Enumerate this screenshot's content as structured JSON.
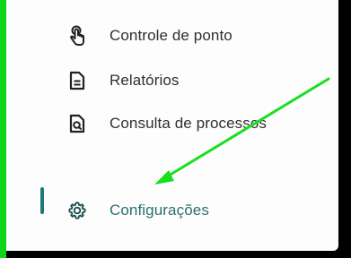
{
  "menu": {
    "items": [
      {
        "label": "Controle de ponto",
        "icon": "touch-hand-icon"
      },
      {
        "label": "Relatórios",
        "icon": "document-icon"
      },
      {
        "label": "Consulta de processos",
        "icon": "document-search-icon"
      },
      {
        "label": "Configurações",
        "icon": "gear-icon",
        "active": true
      }
    ]
  },
  "colors": {
    "accent": "#1e7a78",
    "active_text": "#2a6f70",
    "annotation": "#18e01f",
    "border_green": "#0fd61a"
  }
}
